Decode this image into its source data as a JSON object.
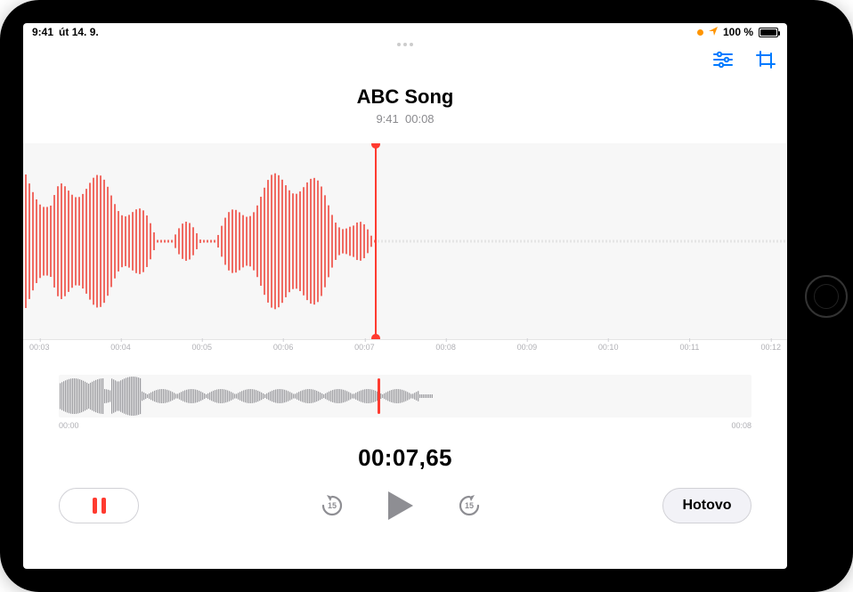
{
  "status": {
    "time": "9:41",
    "date": "út 14. 9.",
    "battery_text": "100 %",
    "location_active": true,
    "recording_indicator": true
  },
  "recording": {
    "title": "ABC Song",
    "recorded_at": "9:41",
    "duration_short": "00:08",
    "current_time": "00:07,65"
  },
  "timeline": {
    "labels": [
      "00:03",
      "00:04",
      "00:05",
      "00:06",
      "00:07",
      "00:08",
      "00:09",
      "00:10",
      "00:11",
      "00:12"
    ],
    "playhead_position_percent": 46
  },
  "mini": {
    "start_label": "00:00",
    "end_label": "00:08",
    "playhead_position_percent": 46
  },
  "controls": {
    "skip_back_seconds": "15",
    "skip_forward_seconds": "15",
    "done_label": "Hotovo"
  },
  "colors": {
    "accent": "#ff3b30",
    "tint": "#007aff",
    "inactive": "#8e8e93"
  }
}
